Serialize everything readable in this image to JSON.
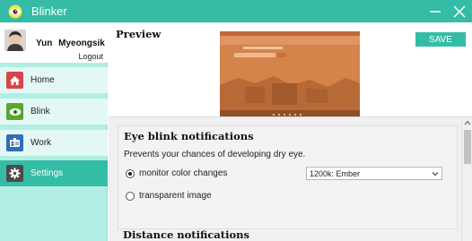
{
  "window": {
    "title": "Blinker",
    "accent_color": "#35bca6"
  },
  "sidebar": {
    "user_name": "Yun Myeongsik",
    "logout_label": "Logout",
    "items": [
      {
        "label": "Home",
        "icon": "house-icon",
        "color": "#d9434c"
      },
      {
        "label": "Blink",
        "icon": "eye-icon",
        "color": "#5aa532"
      },
      {
        "label": "Work",
        "icon": "id-badge-icon",
        "color": "#2f6fb5"
      },
      {
        "label": "Settings",
        "icon": "gear-icon",
        "color": "#4a4a4a",
        "active": true
      }
    ]
  },
  "main": {
    "preview_title": "Preview",
    "save_label": "SAVE",
    "eye_blink": {
      "title": "Eye blink notifications",
      "description": "Prevents your chances of developing dry eye.",
      "option_monitor": "monitor color changes",
      "option_transparent": "transparent image",
      "selected_option": "monitor color changes",
      "color_select_value": "1200k: Ember"
    },
    "distance": {
      "title": "Distance notifications"
    }
  }
}
